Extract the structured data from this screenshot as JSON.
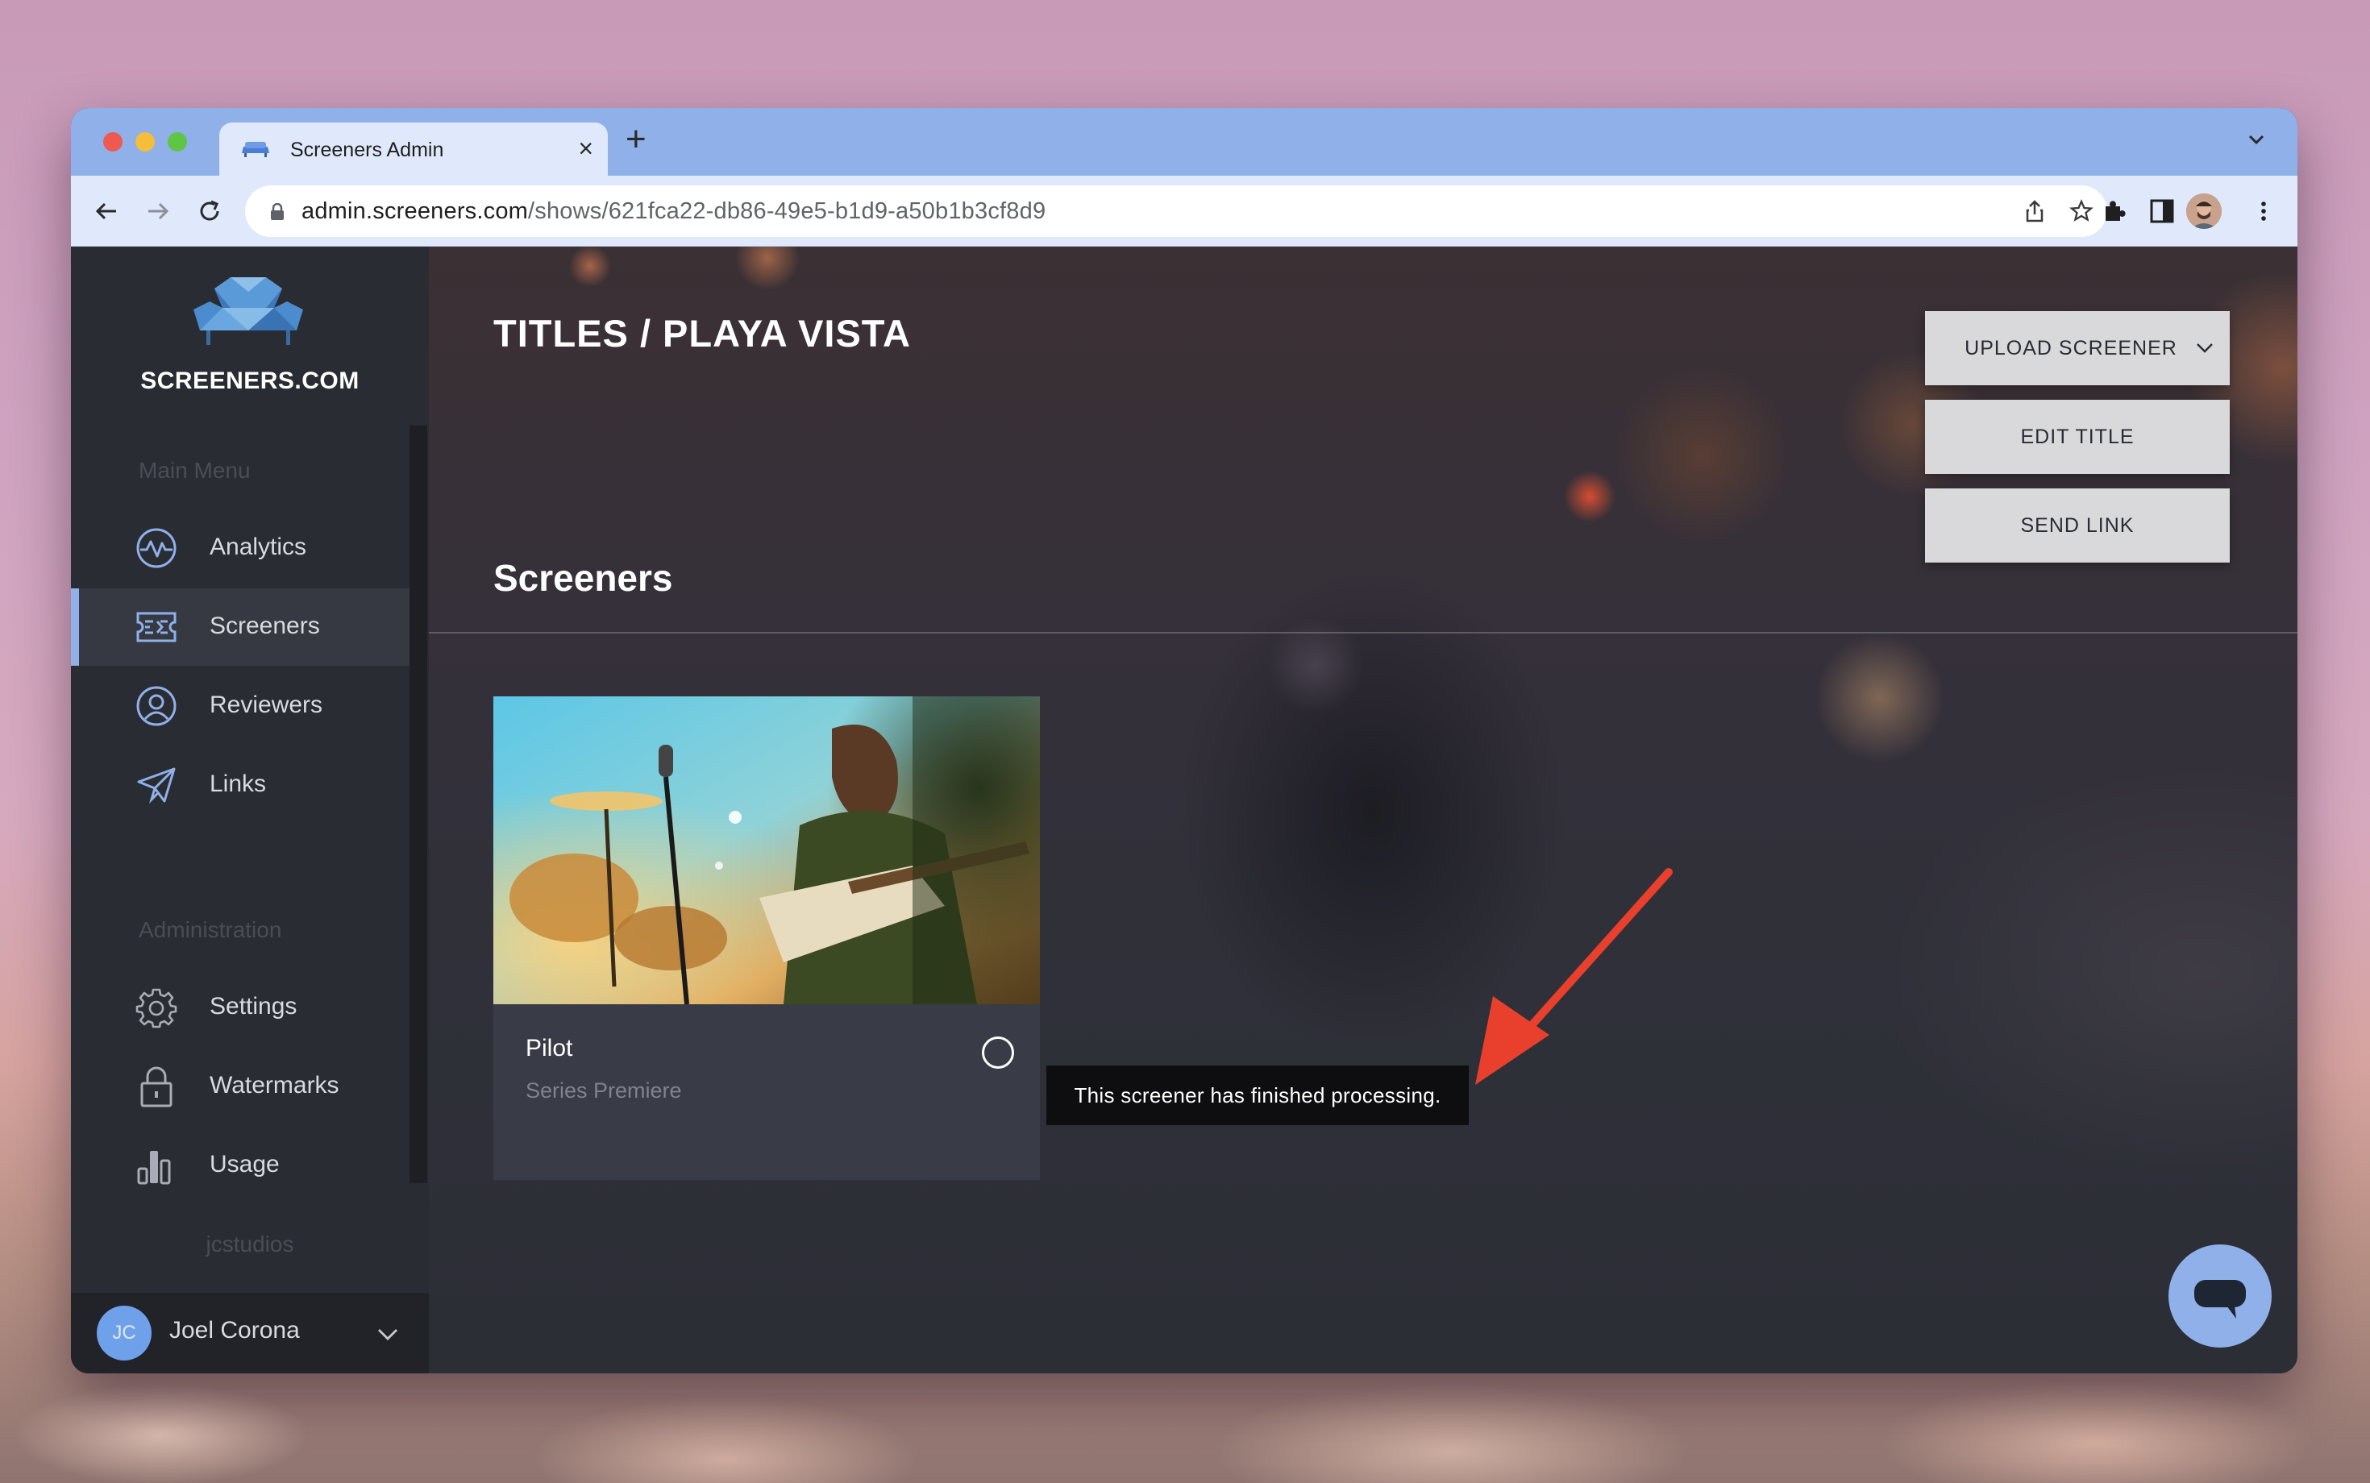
{
  "browser": {
    "tab_title": "Screeners Admin",
    "url_host": "admin.screeners.com",
    "url_path": "/shows/621fca22-db86-49e5-b1d9-a50b1b3cf8d9"
  },
  "sidebar": {
    "brand": "SCREENERS.COM",
    "main_menu_label": "Main Menu",
    "main_items": [
      {
        "label": "Analytics",
        "icon": "analytics-icon"
      },
      {
        "label": "Screeners",
        "icon": "screeners-icon",
        "active": true
      },
      {
        "label": "Reviewers",
        "icon": "reviewers-icon"
      },
      {
        "label": "Links",
        "icon": "paper-plane-icon"
      }
    ],
    "admin_label": "Administration",
    "admin_items": [
      {
        "label": "Settings",
        "icon": "gear-icon"
      },
      {
        "label": "Watermarks",
        "icon": "lock-icon"
      },
      {
        "label": "Usage",
        "icon": "bar-chart-icon"
      }
    ],
    "workspace": "jcstudios",
    "user": {
      "initials": "JC",
      "name": "Joel Corona"
    }
  },
  "main": {
    "page_title": "TITLES / PLAYA VISTA",
    "section_title": "Screeners",
    "buttons": {
      "upload": "UPLOAD SCREENER",
      "edit": "EDIT TITLE",
      "send": "SEND LINK"
    },
    "card": {
      "title": "Pilot",
      "subtitle": "Series Premiere"
    },
    "tooltip": "This screener has finished processing."
  },
  "colors": {
    "accent": "#8fb0e8",
    "sidebar_bg": "#2a2c33",
    "card_bg": "#393b47",
    "arrow": "#e8402d"
  }
}
